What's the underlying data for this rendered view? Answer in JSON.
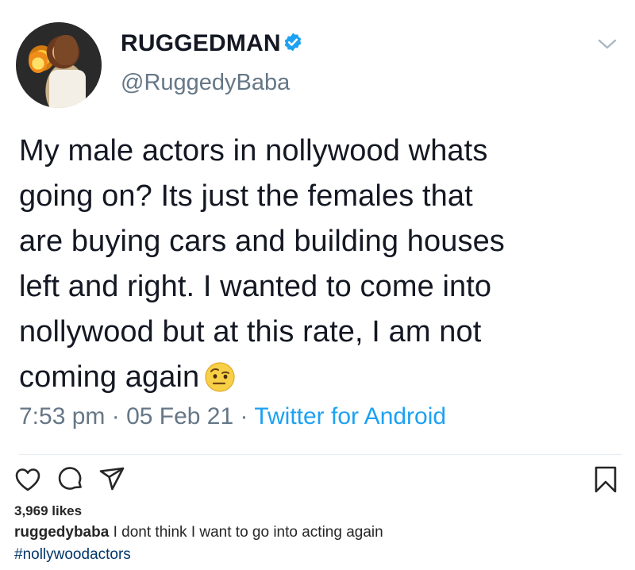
{
  "tweet": {
    "display_name": "RUGGEDMAN",
    "handle": "@RuggedyBaba",
    "text_lines": [
      "My male actors in nollywood whats",
      "going on? Its just the females that",
      "are buying cars and building houses",
      "left and right. I wanted to come into",
      "nollywood but at this rate, I am not",
      "coming again"
    ],
    "emoji_icon": "raised-eyebrow-face-icon",
    "time": "7:53 pm",
    "date": "05 Feb 21",
    "separator": " · ",
    "source": "Twitter for Android",
    "verified_icon": "verified-badge-icon",
    "menu_icon": "chevron-down-icon",
    "accent_color": "#1da1f2"
  },
  "post": {
    "likes": "3,969 likes",
    "caption_user": "ruggedybaba",
    "caption_text": "I dont think I want to go into acting again",
    "hashtag": "#nollywoodactors",
    "actions": [
      "heart-icon",
      "comment-icon",
      "share-icon",
      "bookmark-icon"
    ]
  }
}
